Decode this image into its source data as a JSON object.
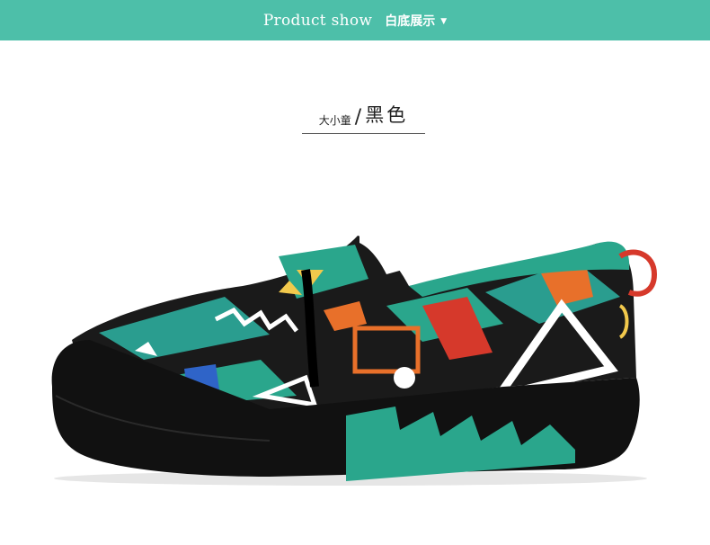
{
  "banner": {
    "english": "Product show",
    "chinese": "白底展示",
    "caret_icon": "caret-down-icon",
    "background": "#4dbfa9"
  },
  "product": {
    "size_label": "大小童",
    "separator": "/",
    "color_name": "黑色"
  },
  "image": {
    "subject": "shoe-photo",
    "sole_color": "#111111",
    "accent_color": "#2aa68c"
  }
}
